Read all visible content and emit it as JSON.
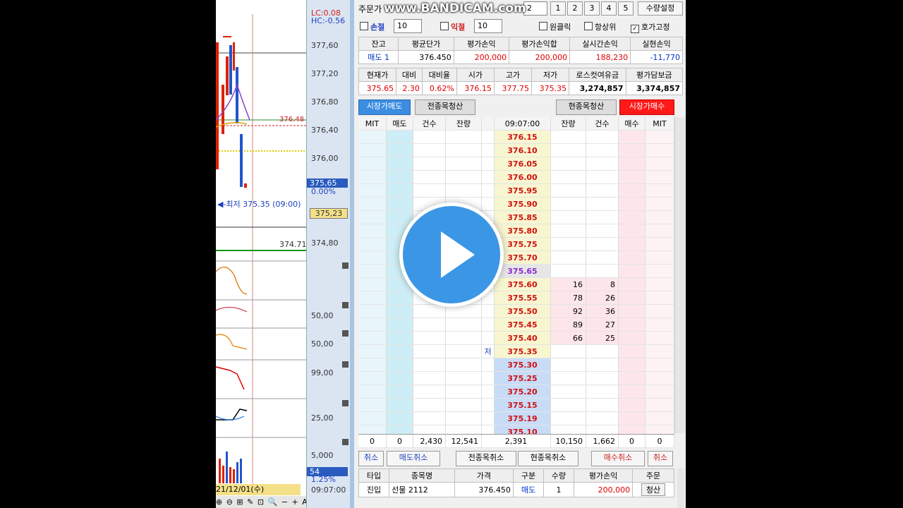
{
  "watermark": "www.BANDICAM.com",
  "chart": {
    "lc": "LC:0.08",
    "hc": "HC:-0.56",
    "axis_labels": [
      "377,60",
      "377,20",
      "376,80",
      "376,40",
      "376,00",
      "375,65",
      "0.00%",
      "375,23",
      "374,80",
      "50,00",
      "50,00",
      "99,00",
      "25,00",
      "5,000",
      "54",
      "1.25%",
      "09:07:00"
    ],
    "line_label_1": "376.48",
    "low_label": "◀-최저 375.35 (09:00)",
    "line_label_2": "374.71",
    "date_label": "21/12/01(수) 09:07:00",
    "bottom_tools": "⊕ ⊖ ⊞ ✎ ⊡ 🔍 − + A"
  },
  "toolbar": {
    "order_type_label": "주문가",
    "qty_value": "2",
    "qty_buttons": [
      "1",
      "2",
      "3",
      "4",
      "5"
    ],
    "qty_settings": "수량설정",
    "stop_loss_label": "손절",
    "stop_loss_value": "10",
    "take_profit_label": "익절",
    "take_profit_value": "10",
    "one_click": "원클릭",
    "always_on_top": "항상위",
    "fix_quote": "호가고정"
  },
  "position": {
    "headers": [
      "잔고",
      "평균단가",
      "평가손익",
      "평가손익합",
      "실시간손익",
      "실현손익"
    ],
    "row": [
      "매도 1",
      "376.450",
      "200,000",
      "200,000",
      "188,230",
      "-11,770"
    ]
  },
  "market": {
    "headers": [
      "현재가",
      "대비",
      "대비율",
      "시가",
      "고가",
      "저가",
      "로스컷여유금",
      "평가담보금"
    ],
    "row": [
      "375.65",
      "2.30",
      "0.62%",
      "376.15",
      "377.75",
      "375.35",
      "3,274,857",
      "3,374,857"
    ]
  },
  "actions": {
    "market_sell": "시장가매도",
    "close_all": "전종목청산",
    "close_current": "현종목청산",
    "market_buy": "시장가매수"
  },
  "book": {
    "headers": [
      "MIT",
      "매도",
      "건수",
      "잔량",
      "",
      "09:07:00",
      "잔량",
      "건수",
      "매수",
      "MIT"
    ],
    "rows": [
      {
        "price": "376.15",
        "type": "ask",
        "qty": "",
        "cnt": "",
        "mark": ""
      },
      {
        "price": "376.10",
        "type": "ask",
        "qty": "",
        "cnt": "",
        "mark": ""
      },
      {
        "price": "376.05",
        "type": "ask",
        "qty": "",
        "cnt": "",
        "mark": ""
      },
      {
        "price": "376.00",
        "type": "ask",
        "qty": "",
        "cnt": "",
        "mark": ""
      },
      {
        "price": "375.95",
        "type": "ask",
        "qty": "",
        "cnt": "",
        "mark": ""
      },
      {
        "price": "375.90",
        "type": "ask",
        "qty": "",
        "cnt": "",
        "mark": ""
      },
      {
        "price": "375.85",
        "type": "ask",
        "qty": "",
        "cnt": "",
        "mark": ""
      },
      {
        "price": "375.80",
        "type": "ask",
        "qty": "",
        "cnt": "",
        "mark": ""
      },
      {
        "price": "375.75",
        "type": "ask",
        "qty": "",
        "cnt": "",
        "mark": ""
      },
      {
        "price": "375.70",
        "type": "ask",
        "qty": "",
        "cnt": "",
        "mark": ""
      },
      {
        "price": "375.65",
        "type": "cur",
        "qty": "",
        "cnt": "",
        "mark": ""
      },
      {
        "price": "375.60",
        "type": "ask",
        "qty": "16",
        "cnt": "8",
        "mark": ""
      },
      {
        "price": "375.55",
        "type": "ask",
        "qty": "78",
        "cnt": "26",
        "mark": ""
      },
      {
        "price": "375.50",
        "type": "ask",
        "qty": "92",
        "cnt": "36",
        "mark": ""
      },
      {
        "price": "375.45",
        "type": "ask",
        "qty": "89",
        "cnt": "27",
        "mark": ""
      },
      {
        "price": "375.40",
        "type": "ask",
        "qty": "66",
        "cnt": "25",
        "mark": ""
      },
      {
        "price": "375.35",
        "type": "ask",
        "qty": "",
        "cnt": "",
        "mark": "저"
      },
      {
        "price": "375.30",
        "type": "bid",
        "qty": "",
        "cnt": "",
        "mark": ""
      },
      {
        "price": "375.25",
        "type": "bid",
        "qty": "",
        "cnt": "",
        "mark": ""
      },
      {
        "price": "375.20",
        "type": "bid",
        "qty": "",
        "cnt": "",
        "mark": ""
      },
      {
        "price": "375.15",
        "type": "bid",
        "qty": "",
        "cnt": "",
        "mark": ""
      },
      {
        "price": "375.19",
        "type": "bid",
        "qty": "",
        "cnt": "",
        "mark": ""
      },
      {
        "price": "375.10",
        "type": "bid",
        "qty": "",
        "cnt": "",
        "mark": ""
      }
    ],
    "totals": [
      "0",
      "0",
      "2,430",
      "12,541",
      "2,391",
      "10,150",
      "1,662",
      "0",
      "0"
    ]
  },
  "cancel": {
    "cancel_left": "취소",
    "sell_cancel": "매도취소",
    "all_cancel": "전종목취소",
    "current_cancel": "현종목취소",
    "buy_cancel": "매수취소",
    "cancel_right": "취소"
  },
  "orders": {
    "headers": [
      "타입",
      "종목명",
      "가격",
      "구분",
      "수량",
      "평가손익",
      "주문"
    ],
    "row": [
      "진입",
      "선물 2112",
      "376.450",
      "매도",
      "1",
      "200,000",
      "청산"
    ]
  }
}
